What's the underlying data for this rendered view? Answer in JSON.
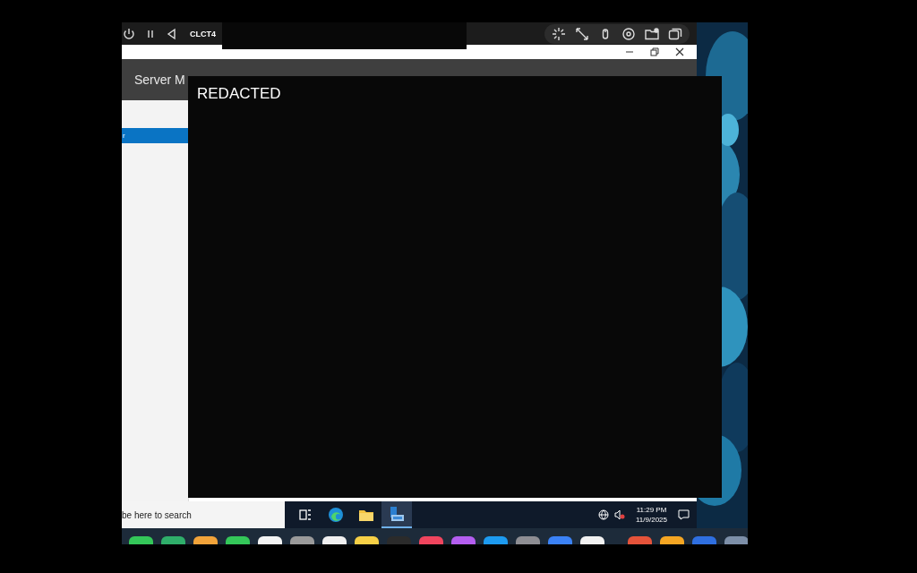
{
  "toolbar": {
    "session_name": "CLCT4"
  },
  "window": {
    "header_title": "Server M"
  },
  "sidebar": {
    "items": [
      {
        "label": "r",
        "selected": true
      }
    ]
  },
  "redaction": {
    "label": "REDACTED"
  },
  "taskbar": {
    "search": {
      "placeholder": "be here to search"
    },
    "apps": [
      {
        "kind": "taskview",
        "selected": false
      },
      {
        "kind": "edge",
        "selected": false
      },
      {
        "kind": "folder",
        "selected": false
      },
      {
        "kind": "server",
        "selected": true
      }
    ],
    "time": "11:29 PM",
    "date": "11/9/2025"
  },
  "dock": {
    "apps": [
      {
        "color": "#34c759"
      },
      {
        "color": "#2fae6a"
      },
      {
        "color": "#f2a33a"
      },
      {
        "color": "#34c759"
      },
      {
        "color": "#f4f4f4"
      },
      {
        "color": "#9a9a9a"
      },
      {
        "color": "#f0f0f0"
      },
      {
        "color": "#f7d046"
      },
      {
        "color": "#2b2b2b"
      },
      {
        "color": "#f0455e"
      },
      {
        "color": "#b45ef0"
      },
      {
        "color": "#1d9bf0"
      },
      {
        "color": "#8e8e93"
      },
      {
        "color": "#3b82f6"
      },
      {
        "color": "#f2f2f2"
      },
      {
        "color": "#e5533a"
      },
      {
        "color": "#f5a623"
      },
      {
        "color": "#2f6fe0"
      },
      {
        "color": "#7d8fa8"
      }
    ]
  }
}
